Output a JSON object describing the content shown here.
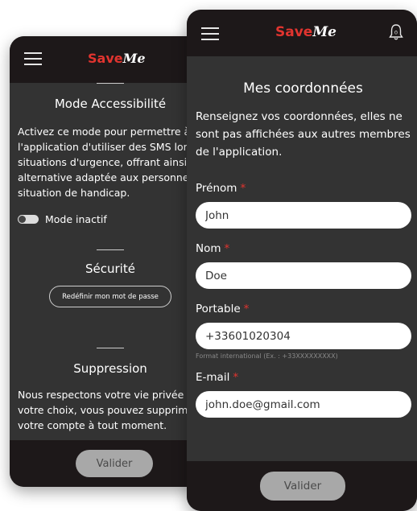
{
  "back_screen": {
    "brand": {
      "save": "Save",
      "me": "Me"
    },
    "accessibility": {
      "title": "Mode Accessibilité",
      "text_lines": [
        "Activez ce mode pour permettre à",
        "l'application d'utiliser des SMS lors",
        "situations d'urgence, offrant ainsi u",
        "alternative adaptée aux personnes",
        "situation de handicap."
      ],
      "toggle_label": "Mode inactif"
    },
    "security": {
      "title": "Sécurité",
      "reset_password_label": "Redéfinir mon mot de passe"
    },
    "deletion": {
      "title": "Suppression",
      "text_lines": [
        "Nous respectons votre vie privée et",
        "votre choix, vous pouvez supprimer",
        "votre compte à tout moment."
      ]
    },
    "submit_label": "Valider"
  },
  "front_screen": {
    "brand": {
      "save": "Save",
      "me": "Me"
    },
    "notification_count": "0",
    "title": "Mes coordonnées",
    "intro": "Renseignez vos coordonnées, elles ne sont pas affichées aux autres membres de l'application.",
    "fields": {
      "prenom": {
        "label": "Prénom",
        "required": "*",
        "value": "John"
      },
      "nom": {
        "label": "Nom",
        "required": "*",
        "value": "Doe"
      },
      "portable": {
        "label": "Portable",
        "required": "*",
        "value": "+33601020304",
        "hint": "Format international (Ex. : +33XXXXXXXXX)"
      },
      "email": {
        "label": "E-mail",
        "required": "*",
        "value": "john.doe@gmail.com"
      }
    },
    "submit_label": "Valider"
  },
  "colors": {
    "header_bg": "#1d1819",
    "screen_bg": "#333333",
    "brand_red": "#e1342f",
    "button_grey": "#a8a8a8"
  },
  "icons": {
    "menu": "hamburger-menu-icon",
    "notifications": "bell-icon"
  }
}
